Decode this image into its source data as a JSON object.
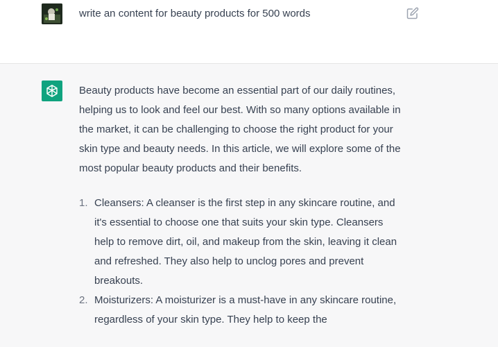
{
  "user_message": {
    "avatar_name": "user-avatar",
    "text": "write an content for beauty products for 500 words"
  },
  "assistant_message": {
    "avatar_icon": "openai-logo-icon",
    "avatar_color": "#10a37f",
    "intro": "Beauty products have become an essential part of our daily routines, helping us to look and feel our best. With so many options available in the market, it can be challenging to choose the right product for your skin type and beauty needs. In this article, we will explore some of the most popular beauty products and their benefits.",
    "list": [
      {
        "number": "1.",
        "text": "Cleansers: A cleanser is the first step in any skincare routine, and it's essential to choose one that suits your skin type. Cleansers help to remove dirt, oil, and makeup from the skin, leaving it clean and refreshed. They also help to unclog pores and prevent breakouts."
      },
      {
        "number": "2.",
        "text": "Moisturizers: A moisturizer is a must-have in any skincare routine, regardless of your skin type. They help to keep the"
      }
    ]
  }
}
